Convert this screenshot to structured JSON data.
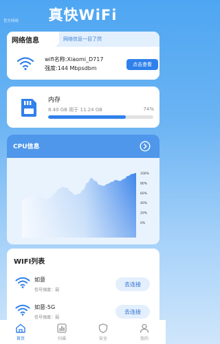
{
  "header": {
    "title": "真快WiFi",
    "corner_tag": "官方网络"
  },
  "network": {
    "tab_label": "网络信息",
    "tagline": "网络信息一目了然",
    "wifi_name_line": "wifi名称:Xiaomi_D717",
    "strength_line": "强度:144 Mbpsdbm",
    "check_button": "点击查看",
    "icon": "wifi-icon"
  },
  "memory": {
    "title": "内存",
    "detail": "8.40 GB 用于 11.24 GB",
    "percent_label": "74%",
    "percent": 74,
    "icon": "sd-card-icon"
  },
  "cpu": {
    "title": "CPU信息",
    "button_icon": "chevron-right-circle-icon",
    "chart_data": {
      "type": "area",
      "y_ticks": [
        "100%",
        "80%",
        "60%",
        "40%",
        "20%",
        "0%"
      ],
      "ylim": [
        0,
        100
      ],
      "values": [
        46,
        50,
        56,
        59,
        56,
        50,
        47,
        50,
        59,
        68,
        72,
        70,
        62,
        56,
        58,
        66,
        80,
        90,
        84,
        76,
        74,
        78,
        82,
        86,
        84,
        88,
        94,
        98,
        100
      ]
    }
  },
  "wifi_list": {
    "title": "WIFI列表",
    "items": [
      {
        "name": "如意",
        "signal": "信号强度：弱",
        "action": "去连接"
      },
      {
        "name": "如意-5G",
        "signal": "信号强度：弱",
        "action": "去连接"
      }
    ]
  },
  "nav": {
    "items": [
      {
        "label": "首页",
        "icon": "home-icon",
        "active": true
      },
      {
        "label": "扫描",
        "icon": "scan-icon",
        "active": false
      },
      {
        "label": "安全",
        "icon": "shield-icon",
        "active": false
      },
      {
        "label": "我的",
        "icon": "user-icon",
        "active": false
      }
    ]
  },
  "colors": {
    "accent": "#2f80ea",
    "header_bg": "#4ea6f2",
    "cpu_head": "#4f97ea"
  }
}
